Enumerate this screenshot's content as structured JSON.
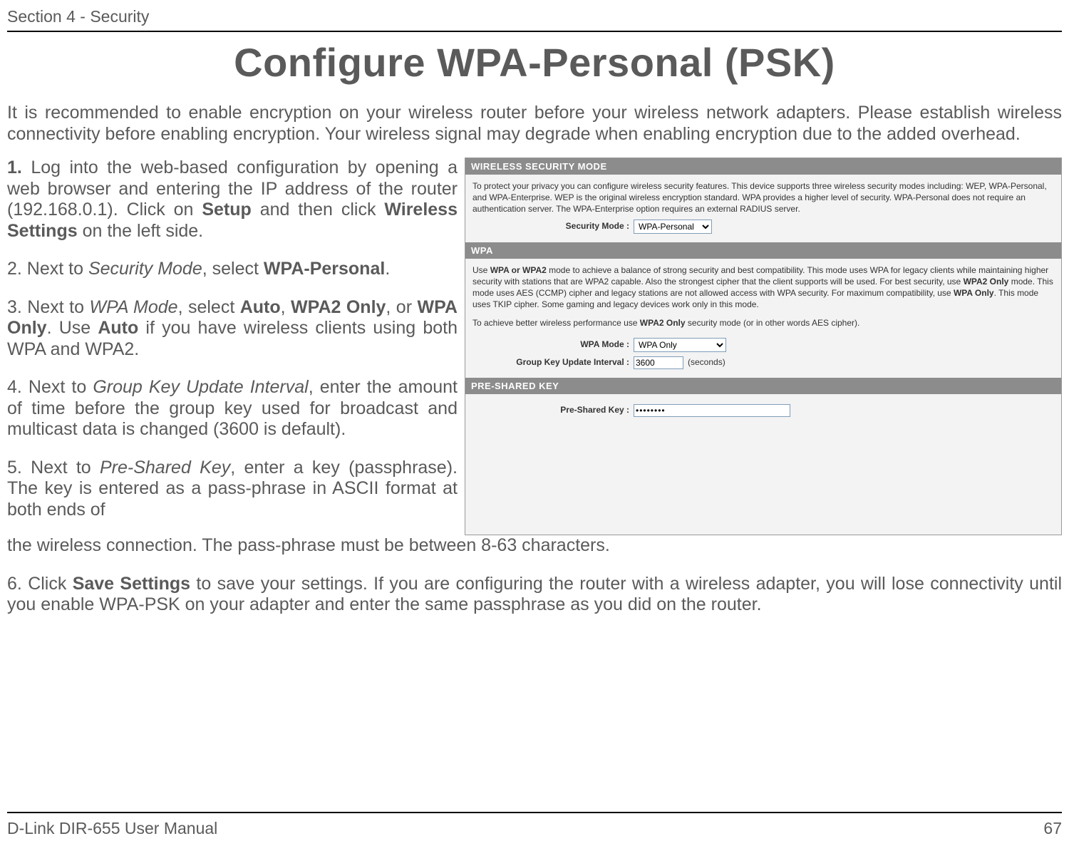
{
  "header": {
    "section": "Section 4 - Security"
  },
  "title": "Configure WPA-Personal (PSK)",
  "intro": "It is recommended to enable encryption on your wireless router before your wireless network adapters. Please establish wireless connectivity before enabling encryption. Your wireless signal may degrade when enabling encryption due to the added overhead.",
  "steps": {
    "s1_num": "1.",
    "s1_a": " Log into the web-based configuration by opening a web browser and entering the IP address of the router (192.168.0.1).  Click on ",
    "s1_b": "Setup",
    "s1_c": " and then click ",
    "s1_d": "Wireless Settings",
    "s1_e": " on the left side.",
    "s2_a": "2. Next to ",
    "s2_b": "Security Mode",
    "s2_c": ", select ",
    "s2_d": "WPA-Personal",
    "s2_e": ".",
    "s3_a": "3. Next to ",
    "s3_b": "WPA Mode",
    "s3_c": ", select ",
    "s3_d": "Auto",
    "s3_e": ", ",
    "s3_f": "WPA2 Only",
    "s3_g": ", or ",
    "s3_h": "WPA Only",
    "s3_i": ". Use ",
    "s3_j": "Auto",
    "s3_k": " if you have wireless clients using both WPA and WPA2.",
    "s4_a": "4. Next to ",
    "s4_b": "Group Key Update Interval",
    "s4_c": ", enter the amount of time before the group key used for broadcast and multicast data is changed (3600 is default).",
    "s5_a": "5. Next to ",
    "s5_b": "Pre-Shared Key",
    "s5_c": ", enter a key (passphrase). The key is entered as a pass-phrase in ASCII format at both ends of the wireless connection. The pass-phrase must be between 8-63 characters.",
    "s6_a": "6. Click ",
    "s6_b": "Save Settings",
    "s6_c": " to save your settings. If you are configuring the router with a wireless adapter, you will lose connectivity until you enable WPA-PSK on your adapter and enter the same passphrase as you did on the router."
  },
  "screenshot": {
    "sec1": {
      "title": "WIRELESS SECURITY MODE",
      "desc": "To protect your privacy you can configure wireless security features. This device supports three wireless security modes including: WEP, WPA-Personal, and WPA-Enterprise. WEP is the original wireless encryption standard. WPA provides a higher level of security. WPA-Personal does not require an authentication server. The WPA-Enterprise option requires an external RADIUS server.",
      "label": "Security Mode :",
      "value": "WPA-Personal"
    },
    "sec2": {
      "title": "WPA",
      "desc_a": "Use ",
      "desc_b": "WPA or WPA2",
      "desc_c": " mode to achieve a balance of strong security and best compatibility. This mode uses WPA for legacy clients while maintaining higher security with stations that are WPA2 capable. Also the strongest cipher that the client supports will be used. For best security, use ",
      "desc_d": "WPA2 Only",
      "desc_e": " mode. This mode uses AES (CCMP) cipher and legacy stations are not allowed access with WPA security. For maximum compatibility, use ",
      "desc_f": "WPA Only",
      "desc_g": ". This mode uses TKIP cipher. Some gaming and legacy devices work only in this mode.",
      "desc2_a": "To achieve better wireless performance use ",
      "desc2_b": "WPA2 Only",
      "desc2_c": " security mode (or in other words AES cipher).",
      "mode_label": "WPA Mode :",
      "mode_value": "WPA Only",
      "interval_label": "Group Key Update Interval :",
      "interval_value": "3600",
      "interval_unit": "(seconds)"
    },
    "sec3": {
      "title": "PRE-SHARED KEY",
      "label": "Pre-Shared Key :",
      "value": "••••••••"
    }
  },
  "footer": {
    "left": "D-Link DIR-655 User Manual",
    "right": "67"
  }
}
